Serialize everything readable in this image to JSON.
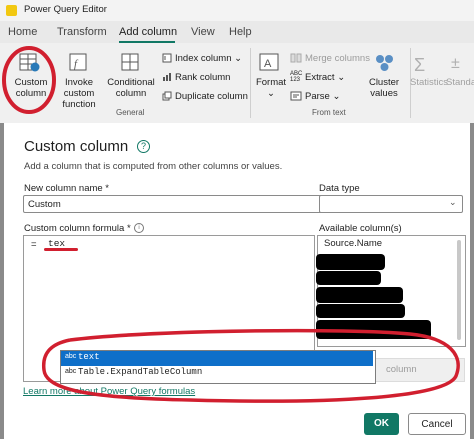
{
  "app": {
    "title": "Power Query Editor"
  },
  "menu": {
    "tabs": [
      "Home",
      "Transform",
      "Add column",
      "View",
      "Help"
    ],
    "active": "Add column"
  },
  "ribbon": {
    "general": {
      "custom_column": "Custom column",
      "invoke_custom_function": "Invoke custom function",
      "conditional_column": "Conditional column",
      "index_column": "Index column",
      "rank_column": "Rank column",
      "duplicate_column": "Duplicate column",
      "group_label": "General"
    },
    "from_text": {
      "format": "Format",
      "merge_columns": "Merge columns",
      "extract": "Extract",
      "parse": "Parse",
      "group_label": "From text"
    },
    "cluster_values": "Cluster values",
    "statistics": "Statistics",
    "standard": "Standa"
  },
  "dialog": {
    "title": "Custom column",
    "description": "Add a column that is computed from other columns or values.",
    "new_column_name_label": "New column name *",
    "new_column_name_value": "Custom",
    "data_type_label": "Data type",
    "formula_label": "Custom column formula *",
    "formula_prefix": "=",
    "formula_value": "tex",
    "available_columns_label": "Available column(s)",
    "available_columns": [
      "Source.Name"
    ],
    "insert_column_label": "column",
    "autocomplete": [
      {
        "kind": "abc",
        "text": "text"
      },
      {
        "kind": "abc",
        "text": "Table.ExpandTableColumn"
      }
    ],
    "learn_more_link": "Learn more about Power Query formulas",
    "ok_label": "OK",
    "cancel_label": "Cancel"
  },
  "colors": {
    "accent": "#117865",
    "selection": "#0e6fc9",
    "annotation": "#d11f2f"
  },
  "icons": [
    "custom-column-icon",
    "invoke-function-icon",
    "conditional-column-icon",
    "index-icon",
    "rank-icon",
    "duplicate-icon",
    "format-icon",
    "merge-icon",
    "extract-icon",
    "parse-icon",
    "cluster-icon",
    "statistics-icon",
    "standard-icon",
    "help-icon",
    "info-icon"
  ]
}
